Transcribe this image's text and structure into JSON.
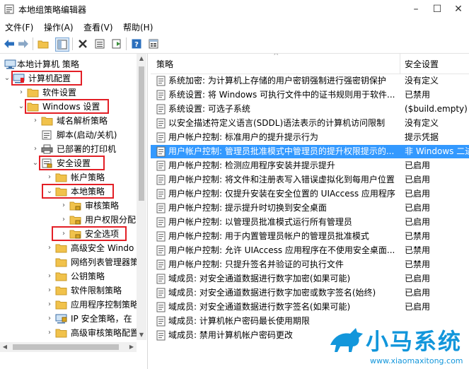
{
  "window": {
    "title": "本地组策略编辑器"
  },
  "menu": {
    "file": "文件(F)",
    "action": "操作(A)",
    "view": "查看(V)",
    "help": "帮助(H)"
  },
  "tree": {
    "items": [
      {
        "label": "本地计算机 策略",
        "expand": "",
        "icon": "computer-icon",
        "highlight": false
      },
      {
        "label": "计算机配置",
        "expand": "⌄",
        "icon": "computer-config-icon",
        "highlight": true
      },
      {
        "label": "软件设置",
        "expand": "›",
        "icon": "folder-icon",
        "highlight": false
      },
      {
        "label": "Windows 设置",
        "expand": "⌄",
        "icon": "folder-icon",
        "highlight": true
      },
      {
        "label": "域名解析策略",
        "expand": "›",
        "icon": "folder-icon",
        "highlight": false
      },
      {
        "label": "脚本(启动/关机)",
        "expand": "",
        "icon": "script-icon",
        "highlight": false
      },
      {
        "label": "已部署的打印机",
        "expand": "›",
        "icon": "printer-icon",
        "highlight": false
      },
      {
        "label": "安全设置",
        "expand": "⌄",
        "icon": "security-icon",
        "highlight": true
      },
      {
        "label": "帐户策略",
        "expand": "›",
        "icon": "folder-icon",
        "highlight": false
      },
      {
        "label": "本地策略",
        "expand": "⌄",
        "icon": "folder-icon",
        "highlight": true
      },
      {
        "label": "审核策略",
        "expand": "›",
        "icon": "folder-lock-icon",
        "highlight": false
      },
      {
        "label": "用户权限分配",
        "expand": "›",
        "icon": "folder-lock-icon",
        "highlight": false
      },
      {
        "label": "安全选项",
        "expand": "›",
        "icon": "folder-lock-icon",
        "highlight": true
      },
      {
        "label": "高级安全 Windo",
        "expand": "›",
        "icon": "folder-icon",
        "highlight": false
      },
      {
        "label": "网络列表管理器策",
        "expand": "",
        "icon": "folder-icon",
        "highlight": false
      },
      {
        "label": "公钥策略",
        "expand": "›",
        "icon": "folder-icon",
        "highlight": false
      },
      {
        "label": "软件限制策略",
        "expand": "›",
        "icon": "folder-icon",
        "highlight": false
      },
      {
        "label": "应用程序控制策略",
        "expand": "›",
        "icon": "folder-icon",
        "highlight": false
      },
      {
        "label": "IP 安全策略，在",
        "expand": "›",
        "icon": "ipsec-icon",
        "highlight": false
      },
      {
        "label": "高级审核策略配置",
        "expand": "›",
        "icon": "folder-icon",
        "highlight": false
      }
    ]
  },
  "list": {
    "col_policy": "策略",
    "col_setting": "安全设置",
    "rows": [
      {
        "name": "系统加密: 为计算机上存储的用户密钥强制进行强密钥保护",
        "value": "没有定义",
        "selected": false
      },
      {
        "name": "系统设置: 将 Windows 可执行文件中的证书规则用于软件...",
        "value": "已禁用",
        "selected": false
      },
      {
        "name": "系统设置: 可选子系统",
        "value": "($build.empty)",
        "selected": false
      },
      {
        "name": "以安全描述符定义语言(SDDL)语法表示的计算机访问限制",
        "value": "没有定义",
        "selected": false
      },
      {
        "name": "用户帐户控制: 标准用户的提升提示行为",
        "value": "提示凭据",
        "selected": false
      },
      {
        "name": "用户帐户控制: 管理员批准模式中管理员的提升权限提示的...",
        "value": "非 Windows 二进",
        "selected": true
      },
      {
        "name": "用户帐户控制: 检测应用程序安装并提示提升",
        "value": "已启用",
        "selected": false
      },
      {
        "name": "用户帐户控制: 将文件和注册表写入错误虚拟化到每用户位置",
        "value": "已启用",
        "selected": false
      },
      {
        "name": "用户帐户控制: 仅提升安装在安全位置的 UIAccess 应用程序",
        "value": "已启用",
        "selected": false
      },
      {
        "name": "用户帐户控制: 提示提升时切换到安全桌面",
        "value": "已启用",
        "selected": false
      },
      {
        "name": "用户帐户控制: 以管理员批准模式运行所有管理员",
        "value": "已启用",
        "selected": false
      },
      {
        "name": "用户帐户控制: 用于内置管理员帐户的管理员批准模式",
        "value": "已禁用",
        "selected": false
      },
      {
        "name": "用户帐户控制: 允许 UIAccess 应用程序在不使用安全桌面...",
        "value": "已禁用",
        "selected": false
      },
      {
        "name": "用户帐户控制: 只提升签名并验证的可执行文件",
        "value": "已禁用",
        "selected": false
      },
      {
        "name": "域成员: 对安全通道数据进行数字加密(如果可能)",
        "value": "已启用",
        "selected": false
      },
      {
        "name": "域成员: 对安全通道数据进行数字加密或数字签名(始终)",
        "value": "已启用",
        "selected": false
      },
      {
        "name": "域成员: 对安全通道数据进行数字签名(如果可能)",
        "value": "已启用",
        "selected": false
      },
      {
        "name": "域成员: 计算机帐户密码最长使用期限",
        "value": "",
        "selected": false
      },
      {
        "name": "域成员: 禁用计算机帐户密码更改",
        "value": "",
        "selected": false
      }
    ]
  },
  "watermark": {
    "brand": "小马系统",
    "url": "www.xiaomaxitong.com"
  },
  "colors": {
    "highlight_box": "#e31f26",
    "selection": "#3399ff",
    "watermark": "#1296db",
    "folder": "#f1c24b"
  }
}
